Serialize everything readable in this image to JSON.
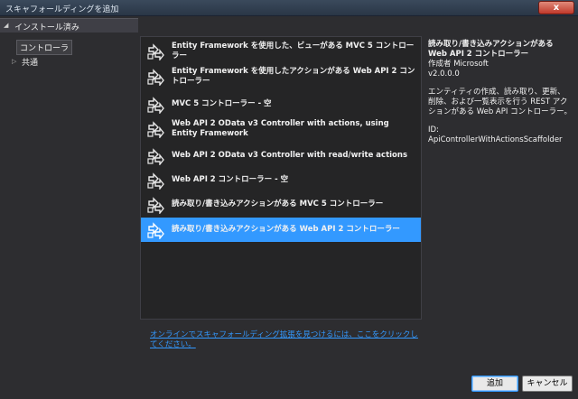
{
  "window": {
    "title": "スキャフォールディングを追加",
    "close_glyph": "x"
  },
  "sidebar": {
    "header": "インストール済み",
    "items": [
      {
        "label": "コントローラ",
        "selected": true
      },
      {
        "label": "共通",
        "selected": false
      }
    ]
  },
  "templates": [
    {
      "label": "Entity Framework を使用した、ビューがある MVC 5 コントローラー",
      "icon": "scaffold-mvc-icon"
    },
    {
      "label": "Entity Framework を使用したアクションがある Web API 2 コントローラー",
      "icon": "scaffold-api-icon"
    },
    {
      "label": "MVC 5 コントローラー - 空",
      "icon": "scaffold-icon"
    },
    {
      "label": "Web API 2 OData v3 Controller with actions, using Entity Framework",
      "icon": "scaffold-icon"
    },
    {
      "label": "Web API 2 OData v3 Controller with read/write actions",
      "icon": "scaffold-icon"
    },
    {
      "label": "Web API 2 コントローラー - 空",
      "icon": "scaffold-icon"
    },
    {
      "label": "読み取り/書き込みアクションがある MVC 5 コントローラー",
      "icon": "scaffold-icon"
    },
    {
      "label": "読み取り/書き込みアクションがある Web API 2 コントローラー",
      "icon": "scaffold-icon",
      "selected": true
    }
  ],
  "details": {
    "name": "読み取り/書き込みアクションがある Web API 2 コントローラー",
    "author": "作成者 Microsoft",
    "version": "v2.0.0.0",
    "description": "エンティティの作成、読み取り、更新、削除、および一覧表示を行う REST アクションがある Web API コントローラー。",
    "id": "ID: ApiControllerWithActionsScaffolder"
  },
  "online_link": "オンラインでスキャフォールディング拡張を見つけるには、ここをクリックしてください。",
  "buttons": {
    "add": "追加",
    "cancel": "キャンセル"
  },
  "colors": {
    "selection": "#3399ff",
    "background": "#2d2d30",
    "list_background": "#252526",
    "link": "#3399ff"
  }
}
